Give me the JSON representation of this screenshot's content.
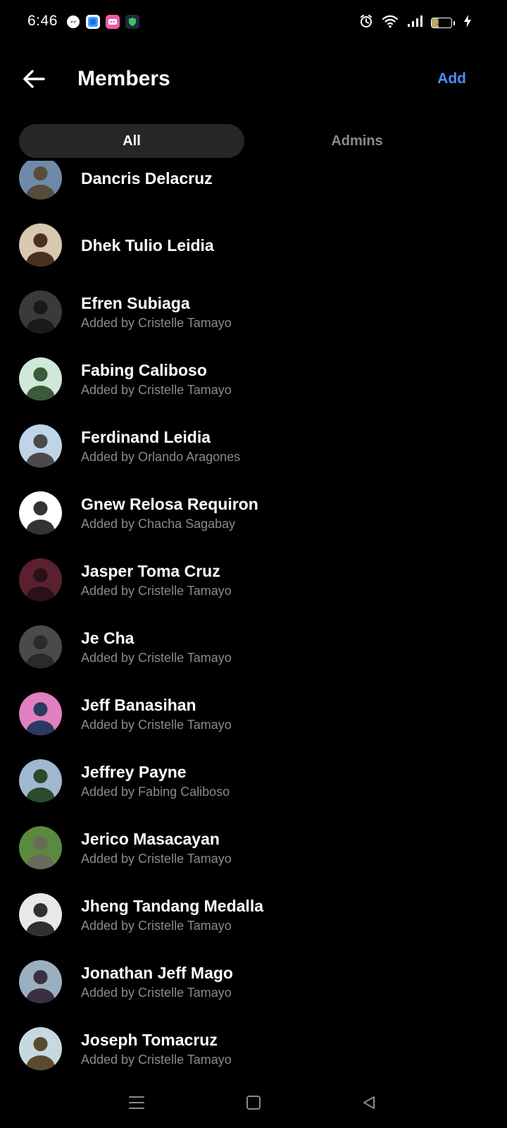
{
  "status_bar": {
    "time": "6:46",
    "battery_percent": 35,
    "battery_label": "35",
    "notification_icons": [
      "messenger-icon",
      "blue-app-icon",
      "pink-app-icon",
      "shield-app-icon"
    ],
    "system_icons": [
      "alarm-icon",
      "wifi-icon",
      "signal-icon",
      "battery-icon",
      "charging-icon"
    ]
  },
  "header": {
    "back_icon": "arrow-left-icon",
    "title": "Members",
    "add_label": "Add"
  },
  "tabs": [
    {
      "label": "All",
      "active": true
    },
    {
      "label": "Admins",
      "active": false
    }
  ],
  "members": [
    {
      "name": "Dancris Delacruz",
      "added_by": ""
    },
    {
      "name": "Dhek Tulio Leidia",
      "added_by": ""
    },
    {
      "name": "Efren Subiaga",
      "added_by": "Added by Cristelle Tamayo"
    },
    {
      "name": "Fabing Caliboso",
      "added_by": "Added by Cristelle Tamayo"
    },
    {
      "name": "Ferdinand Leidia",
      "added_by": "Added by Orlando Aragones"
    },
    {
      "name": "Gnew Relosa Requiron",
      "added_by": "Added by Chacha Sagabay"
    },
    {
      "name": "Jasper Toma Cruz",
      "added_by": "Added by Cristelle Tamayo"
    },
    {
      "name": "Je Cha",
      "added_by": "Added by Cristelle Tamayo"
    },
    {
      "name": "Jeff Banasihan",
      "added_by": "Added by Cristelle Tamayo"
    },
    {
      "name": "Jeffrey Payne",
      "added_by": "Added by Fabing Caliboso"
    },
    {
      "name": "Jerico Masacayan",
      "added_by": "Added by Cristelle Tamayo"
    },
    {
      "name": "Jheng Tandang Medalla",
      "added_by": "Added by Cristelle Tamayo"
    },
    {
      "name": "Jonathan Jeff Mago",
      "added_by": "Added by Cristelle Tamayo"
    },
    {
      "name": "Joseph Tomacruz",
      "added_by": "Added by Cristelle Tamayo"
    }
  ],
  "avatar_colors": [
    [
      "#6f8aa8",
      "#5a4a3a"
    ],
    [
      "#d8c8b0",
      "#4a3020"
    ],
    [
      "#3a3a3a",
      "#1a1a1a"
    ],
    [
      "#cfe8d8",
      "#3a5a3a"
    ],
    [
      "#c0d4e8",
      "#4a4a4a"
    ],
    [
      "#ffffff",
      "#333333"
    ],
    [
      "#5a2030",
      "#2a1018"
    ],
    [
      "#4a4a4a",
      "#2a2a2a"
    ],
    [
      "#e080c0",
      "#2a3a60"
    ],
    [
      "#a0b8d0",
      "#2a4a2a"
    ],
    [
      "#5a8a40",
      "#6a6a5a"
    ],
    [
      "#e8e8e8",
      "#303030"
    ],
    [
      "#9ab0c0",
      "#3a3040"
    ],
    [
      "#c8d8e0",
      "#5a4a30"
    ]
  ],
  "nav_bar": {
    "icons": [
      "menu-icon",
      "home-square-icon",
      "back-triangle-icon"
    ]
  }
}
